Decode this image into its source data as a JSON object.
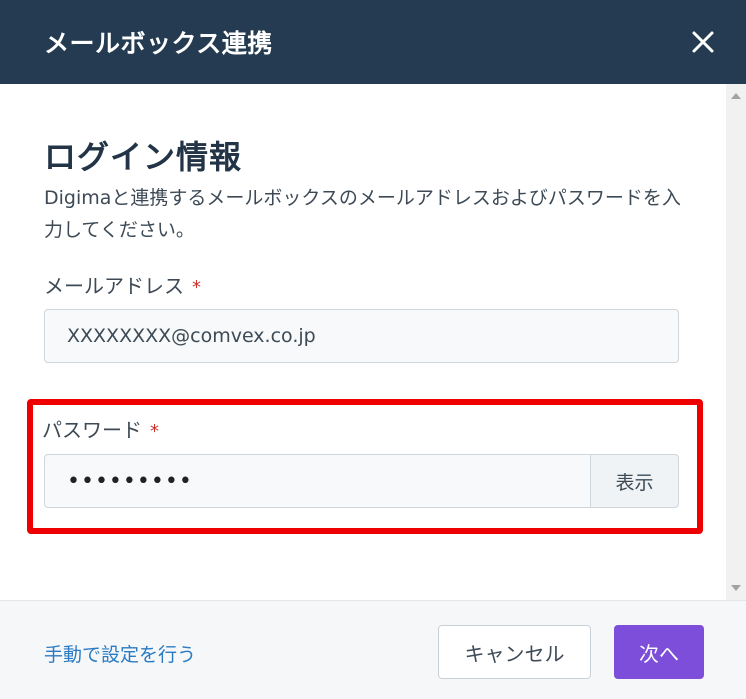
{
  "header": {
    "title": "メールボックス連携",
    "close_icon": "close-icon"
  },
  "content": {
    "section_title": "ログイン情報",
    "description": "Digimaと連携するメールボックスのメールアドレスおよびパスワードを入力してください。",
    "email": {
      "label": "メールアドレス",
      "required_mark": "*",
      "value": "XXXXXXXX@comvex.co.jp"
    },
    "password": {
      "label": "パスワード",
      "required_mark": "*",
      "value": "•••••••••",
      "show_label": "表示"
    }
  },
  "footer": {
    "manual_link": "手動で設定を行う",
    "cancel_label": "キャンセル",
    "next_label": "次へ"
  },
  "colors": {
    "header_bg": "#243b52",
    "accent": "#7c4ed9",
    "link": "#2a7bc4",
    "highlight": "#ee0000",
    "required": "#d0312d"
  }
}
